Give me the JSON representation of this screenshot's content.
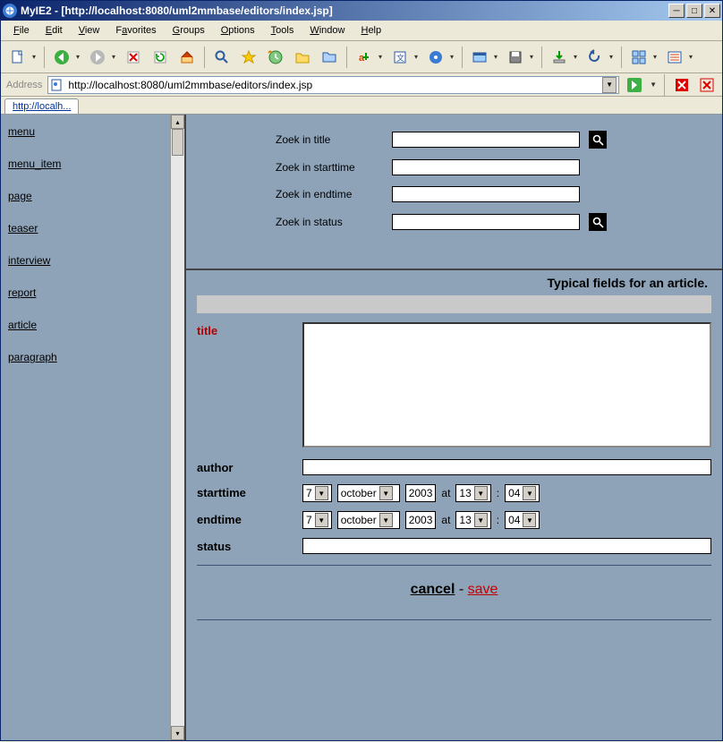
{
  "window": {
    "title": "MyIE2 - [http://localhost:8080/uml2mmbase/editors/index.jsp]"
  },
  "menubar": [
    "File",
    "Edit",
    "View",
    "Favorites",
    "Groups",
    "Options",
    "Tools",
    "Window",
    "Help"
  ],
  "addressbar": {
    "label": "Address",
    "url": "http://localhost:8080/uml2mmbase/editors/index.jsp"
  },
  "tab": {
    "label": "http://localh..."
  },
  "sidebar": {
    "items": [
      "menu",
      "menu_item",
      "page",
      "teaser",
      "interview",
      "report",
      "article",
      "paragraph"
    ]
  },
  "search": {
    "rows": [
      {
        "label": "Zoek in title",
        "has_btn": true
      },
      {
        "label": "Zoek in starttime",
        "has_btn": false
      },
      {
        "label": "Zoek in endtime",
        "has_btn": false
      },
      {
        "label": "Zoek in status",
        "has_btn": true
      }
    ]
  },
  "form": {
    "header": "Typical fields for an article.",
    "title_label": "title",
    "author_label": "author",
    "starttime_label": "starttime",
    "endtime_label": "endtime",
    "status_label": "status",
    "at": "at",
    "colon": ":",
    "sep": " - ",
    "cancel": "cancel",
    "save": "save",
    "start": {
      "day": "7",
      "month": "october",
      "year": "2003",
      "hour": "13",
      "min": "04"
    },
    "end": {
      "day": "7",
      "month": "october",
      "year": "2003",
      "hour": "13",
      "min": "04"
    }
  },
  "toolbar_icons": [
    "new-page",
    "back",
    "forward",
    "stop",
    "refresh",
    "home",
    "search",
    "favorites",
    "history",
    "folders",
    "messages",
    "autofill",
    "translate",
    "media",
    "fullscreen",
    "save-group",
    "download",
    "undo",
    "tile",
    "options"
  ]
}
